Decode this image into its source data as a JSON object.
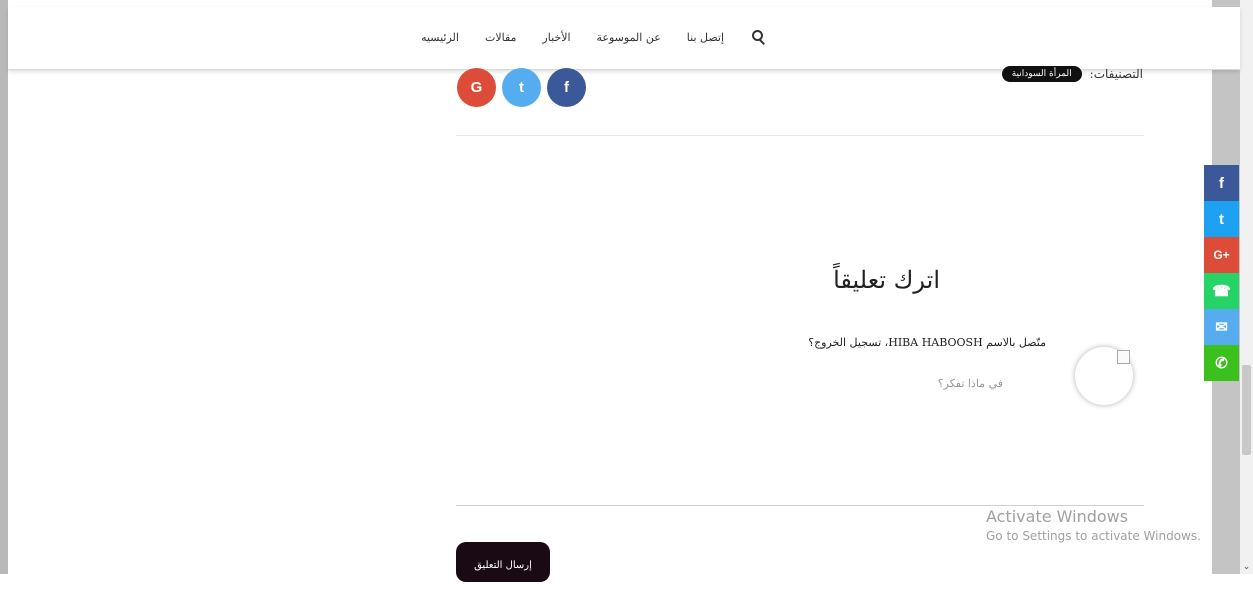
{
  "nav": {
    "items": [
      "الرئيسيه",
      "مقالات",
      "الأخبار",
      "عن الموسوعة",
      "إتصل بنا"
    ]
  },
  "categories": {
    "label": "التصنيفات:",
    "tag": "المرأة السودانية"
  },
  "share_round": {
    "google": "G",
    "twitter": "t",
    "facebook": "f"
  },
  "comment": {
    "title": "اترك تعليقاً",
    "logged_in": "متّصل بالاسم HIBA HABOOSH، تسجيل الخروج؟",
    "placeholder": "في ماذا تفكر؟",
    "submit": "إرسال التعليق"
  },
  "side_share": {
    "facebook": "f",
    "twitter": "t",
    "gplus": "G+",
    "whatsapp": "☎",
    "email": "✉",
    "phone": "✆"
  },
  "watermark": {
    "line1": "Activate Windows",
    "line2": "Go to Settings to activate Windows."
  },
  "colors": {
    "facebook": "#3b5998",
    "twitter": "#55acee",
    "google": "#dd4b39",
    "whatsapp": "#25d366",
    "submit_bg": "#1a0a13"
  }
}
